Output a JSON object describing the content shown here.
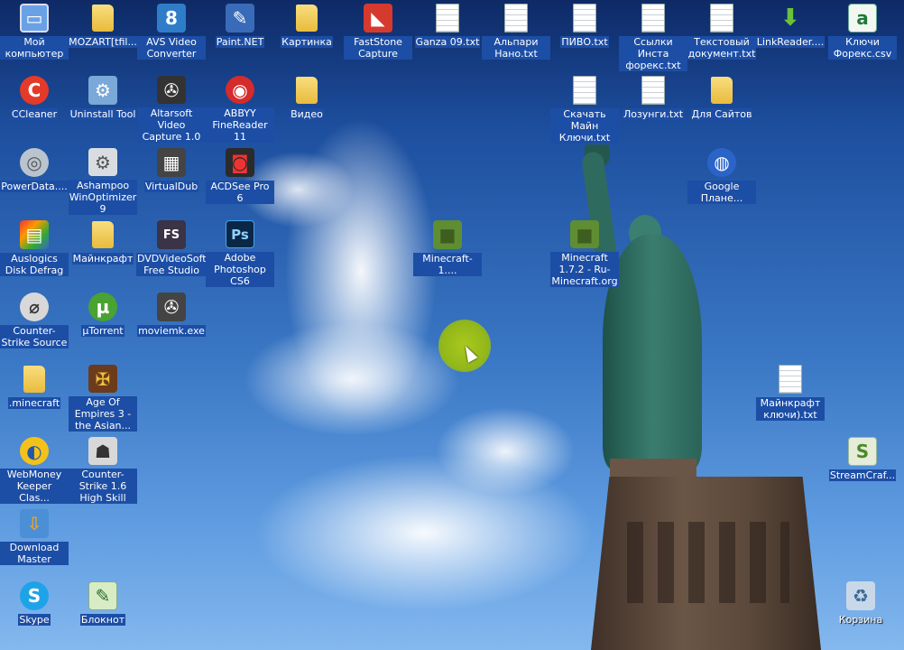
{
  "desktop": {
    "icons": [
      {
        "label": "Мой компьютер",
        "icon": "computer-icon",
        "sel": true
      },
      {
        "label": "MOZART[tfil...",
        "icon": "folder-icon",
        "sel": true
      },
      {
        "label": "AVS Video Converter",
        "icon": "avs-video-icon",
        "sel": true
      },
      {
        "label": "Paint.NET",
        "icon": "paint-net-icon",
        "sel": true
      },
      {
        "label": "Картинка",
        "icon": "folder-icon",
        "sel": true
      },
      {
        "label": "FastStone Capture",
        "icon": "faststone-icon",
        "sel": true
      },
      {
        "label": "Ganza 09.txt",
        "icon": "text-file-icon",
        "sel": true
      },
      {
        "label": "Альпари Нано.txt",
        "icon": "text-file-icon",
        "sel": true
      },
      {
        "label": "ПИВО.txt",
        "icon": "text-file-icon",
        "sel": true
      },
      {
        "label": "Ссылки Инста форекс.txt",
        "icon": "text-file-icon",
        "sel": true
      },
      {
        "label": "Текстовый документ.txt",
        "icon": "text-file-icon",
        "sel": true
      },
      {
        "label": "LinkReader....",
        "icon": "download-arrow-icon",
        "sel": true
      },
      {
        "label": "Ключи Форекс.csv",
        "icon": "spreadsheet-icon",
        "sel": true
      },
      {
        "label": "CCleaner",
        "icon": "ccleaner-icon",
        "sel": true
      },
      {
        "label": "Uninstall Tool",
        "icon": "uninstall-tool-icon",
        "sel": true
      },
      {
        "label": "Altarsoft Video Capture 1.0",
        "icon": "film-reel-icon",
        "sel": true
      },
      {
        "label": "ABBYY FineReader 11",
        "icon": "abbyy-icon",
        "sel": true
      },
      {
        "label": "Видео",
        "icon": "folder-icon",
        "sel": true
      },
      {
        "label": "Скачать Майн Ключи.txt",
        "icon": "text-file-icon",
        "sel": true
      },
      {
        "label": "Лозунги.txt",
        "icon": "text-file-icon",
        "sel": true
      },
      {
        "label": "Для Сайтов",
        "icon": "folder-icon",
        "sel": true
      },
      {
        "label": "PowerData....",
        "icon": "disc-icon",
        "sel": true
      },
      {
        "label": "Ashampoo WinOptimizer 9",
        "icon": "gear-icon",
        "sel": true
      },
      {
        "label": "VirtualDub",
        "icon": "virtualdub-icon",
        "sel": true
      },
      {
        "label": "ACDSee Pro 6",
        "icon": "camera-icon",
        "sel": true
      },
      {
        "label": "Google Плане...",
        "icon": "google-earth-icon",
        "sel": true
      },
      {
        "label": "Auslogics Disk Defrag",
        "icon": "defrag-icon",
        "sel": true
      },
      {
        "label": "Майнкрафт",
        "icon": "folder-icon",
        "sel": true
      },
      {
        "label": "DVDVideoSoft Free Studio",
        "icon": "dvdvideosoft-icon",
        "sel": true
      },
      {
        "label": "Adobe Photoshop CS6",
        "icon": "photoshop-icon",
        "sel": true
      },
      {
        "label": "Minecraft-1....",
        "icon": "minecraft-block-icon",
        "sel": true
      },
      {
        "label": "Minecraft 1.7.2 - Ru-Minecraft.org",
        "icon": "minecraft-block-icon",
        "sel": true
      },
      {
        "label": "Counter-Strike Source",
        "icon": "counter-strike-source-icon",
        "sel": true
      },
      {
        "label": "µTorrent",
        "icon": "utorrent-icon",
        "sel": true
      },
      {
        "label": "moviemk.exe",
        "icon": "film-reel-icon",
        "sel": true
      },
      {
        "label": ".minecraft",
        "icon": "folder-icon",
        "sel": true
      },
      {
        "label": "Age Of Empires 3 - the Asian...",
        "icon": "age-of-empires-icon",
        "sel": true
      },
      {
        "label": "Майнкрафт ключи).txt",
        "icon": "text-file-icon",
        "sel": true
      },
      {
        "label": "WebMoney Keeper Clas...",
        "icon": "webmoney-icon",
        "sel": true
      },
      {
        "label": "Counter-Strike 1.6 High Skill",
        "icon": "counter-strike-icon",
        "sel": true
      },
      {
        "label": "StreamCraf...",
        "icon": "streamcraft-icon",
        "sel": true
      },
      {
        "label": "Download Master",
        "icon": "download-master-icon",
        "sel": true
      },
      {
        "label": "Skype",
        "icon": "skype-icon",
        "sel": true
      },
      {
        "label": "Блокнот",
        "icon": "notepad-icon",
        "sel": true
      },
      {
        "label": "Корзина",
        "icon": "recycle-bin-icon",
        "sel": false
      }
    ]
  },
  "glyphs": {
    "avs": "8",
    "paint": "✎",
    "faststone": "◣",
    "ccleaner": "C",
    "uninstall": "⚙",
    "abbyy": "◉",
    "disc": "◎",
    "gear": "⚙",
    "virtualdub": "▦",
    "camera": "◙",
    "google_earth": "◍",
    "defrag": "▤",
    "dvd": "FS",
    "ps": "Ps",
    "cs": "⌀",
    "utorrent": "µ",
    "film": "✇",
    "aoe": "✠",
    "webmoney": "◐",
    "cs16": "☗",
    "streamcraft": "S",
    "dm": "⇩",
    "skype": "S",
    "notepad": "✎",
    "recycle": "♻",
    "computer": "▭",
    "arrow": "⬇",
    "sheet": "a",
    "mc": "■"
  }
}
